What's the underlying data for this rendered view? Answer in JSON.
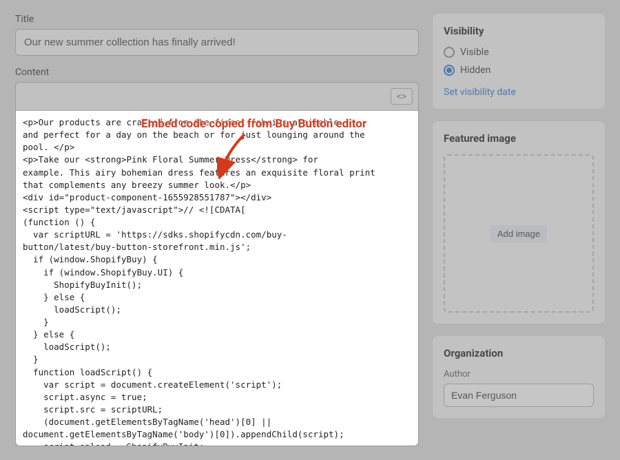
{
  "main": {
    "title_label": "Title",
    "title_value": "Our new summer collection has finally arrived!",
    "content_label": "Content",
    "code_toggle_label": "<>",
    "code_text": "<p>Our products are crafted from the finest fabrics available\nand perfect for a day on the beach or for just lounging around the\npool. </p>\n<p>Take our <strong>Pink Floral Summer Dress</strong> for\nexample. This airy bohemian dress features an exquisite floral print\nthat complements any breezy summer look.</p>\n<div id=\"product-component-1655928551787\"></div>\n<script type=\"text/javascript\">// <![CDATA[\n(function () {\n  var scriptURL = 'https://sdks.shopifycdn.com/buy-\nbutton/latest/buy-button-storefront.min.js';\n  if (window.ShopifyBuy) {\n    if (window.ShopifyBuy.UI) {\n      ShopifyBuyInit();\n    } else {\n      loadScript();\n    }\n  } else {\n    loadScript();\n  }\n  function loadScript() {\n    var script = document.createElement('script');\n    script.async = true;\n    script.src = scriptURL;\n    (document.getElementsByTagName('head')[0] ||\ndocument.getElementsByTagName('body')[0]).appendChild(script);\n    script.onload = ShopifyBuyInit;\n  }\n  function ShopifyBuyInit() {\n    var client = ShopifyBuy.buildClient({\n      domain: 'evans-test-store.myshopify.com',\n      storefrontAccessToken: '81e03ec3a34459aa48775563c082de27',\n    });\n    ShopifyBuy.UI.onReady(client).then(function (ui) {\n      ui.createComponent('product', {"
  },
  "annotation": {
    "text": "Embed code copied from Buy Button editor"
  },
  "side": {
    "visibility": {
      "heading": "Visibility",
      "options": [
        "Visible",
        "Hidden"
      ],
      "selected": "Hidden",
      "link": "Set visibility date"
    },
    "featured": {
      "heading": "Featured image",
      "button": "Add image"
    },
    "organization": {
      "heading": "Organization",
      "author_label": "Author",
      "author_value": "Evan Ferguson"
    }
  }
}
